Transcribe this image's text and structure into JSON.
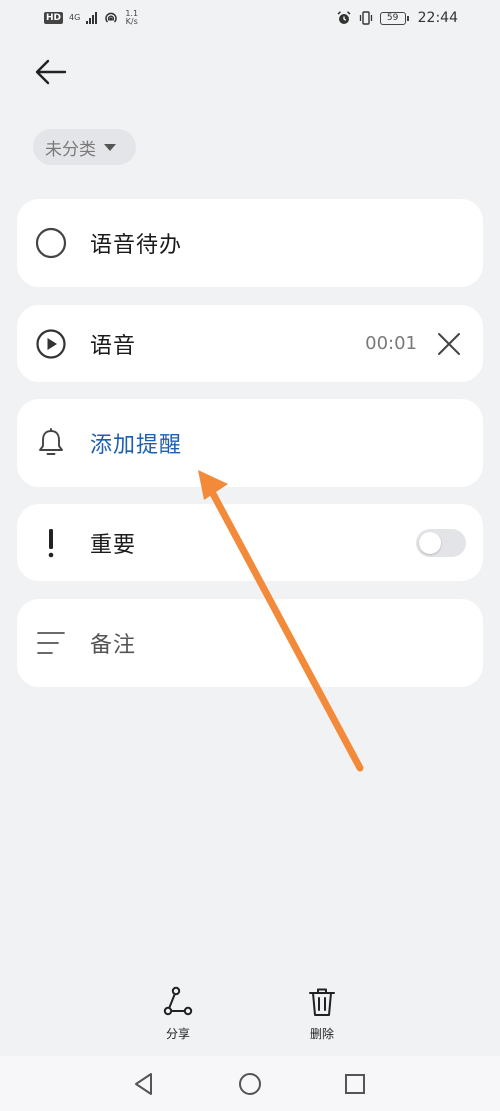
{
  "status_bar": {
    "hd": "HD",
    "net_type": "4G",
    "speed_value": "1.1",
    "speed_unit": "K/s",
    "battery": "59",
    "time": "22:44"
  },
  "category": {
    "selected": "未分类"
  },
  "todo": {
    "title": "语音待办"
  },
  "voice": {
    "label": "语音",
    "duration": "00:01"
  },
  "reminder": {
    "label": "添加提醒"
  },
  "important": {
    "label": "重要",
    "enabled": false
  },
  "note": {
    "label": "备注"
  },
  "actions": {
    "share": "分享",
    "delete": "删除"
  },
  "colors": {
    "accent": "#1c5fb5",
    "annotation_arrow": "#f28a3a",
    "background": "#f1f2f4"
  }
}
